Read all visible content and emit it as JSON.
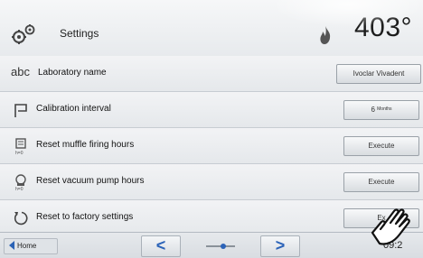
{
  "header": {
    "title": "Settings",
    "temperature": "403°",
    "icons": {
      "settings": "gears-icon",
      "heating": "flame-icon"
    }
  },
  "rows": [
    {
      "icon": "abc",
      "label": "Laboratory name",
      "value": "Ivoclar Vivadent"
    },
    {
      "icon": "calibration-icon",
      "label": "Calibration interval",
      "value": "6",
      "unit": "Months"
    },
    {
      "icon": "muffle-hours-icon",
      "label": "Reset muffle firing hours",
      "value": "Execute"
    },
    {
      "icon": "vacuum-pump-icon",
      "label": "Reset vacuum pump hours",
      "value": "Execute"
    },
    {
      "icon": "reset-icon",
      "label": "Reset to factory settings",
      "value": "Ex"
    }
  ],
  "footer": {
    "home_label": "Home",
    "prev_label": "<",
    "next_label": ">",
    "time": "09:2"
  }
}
